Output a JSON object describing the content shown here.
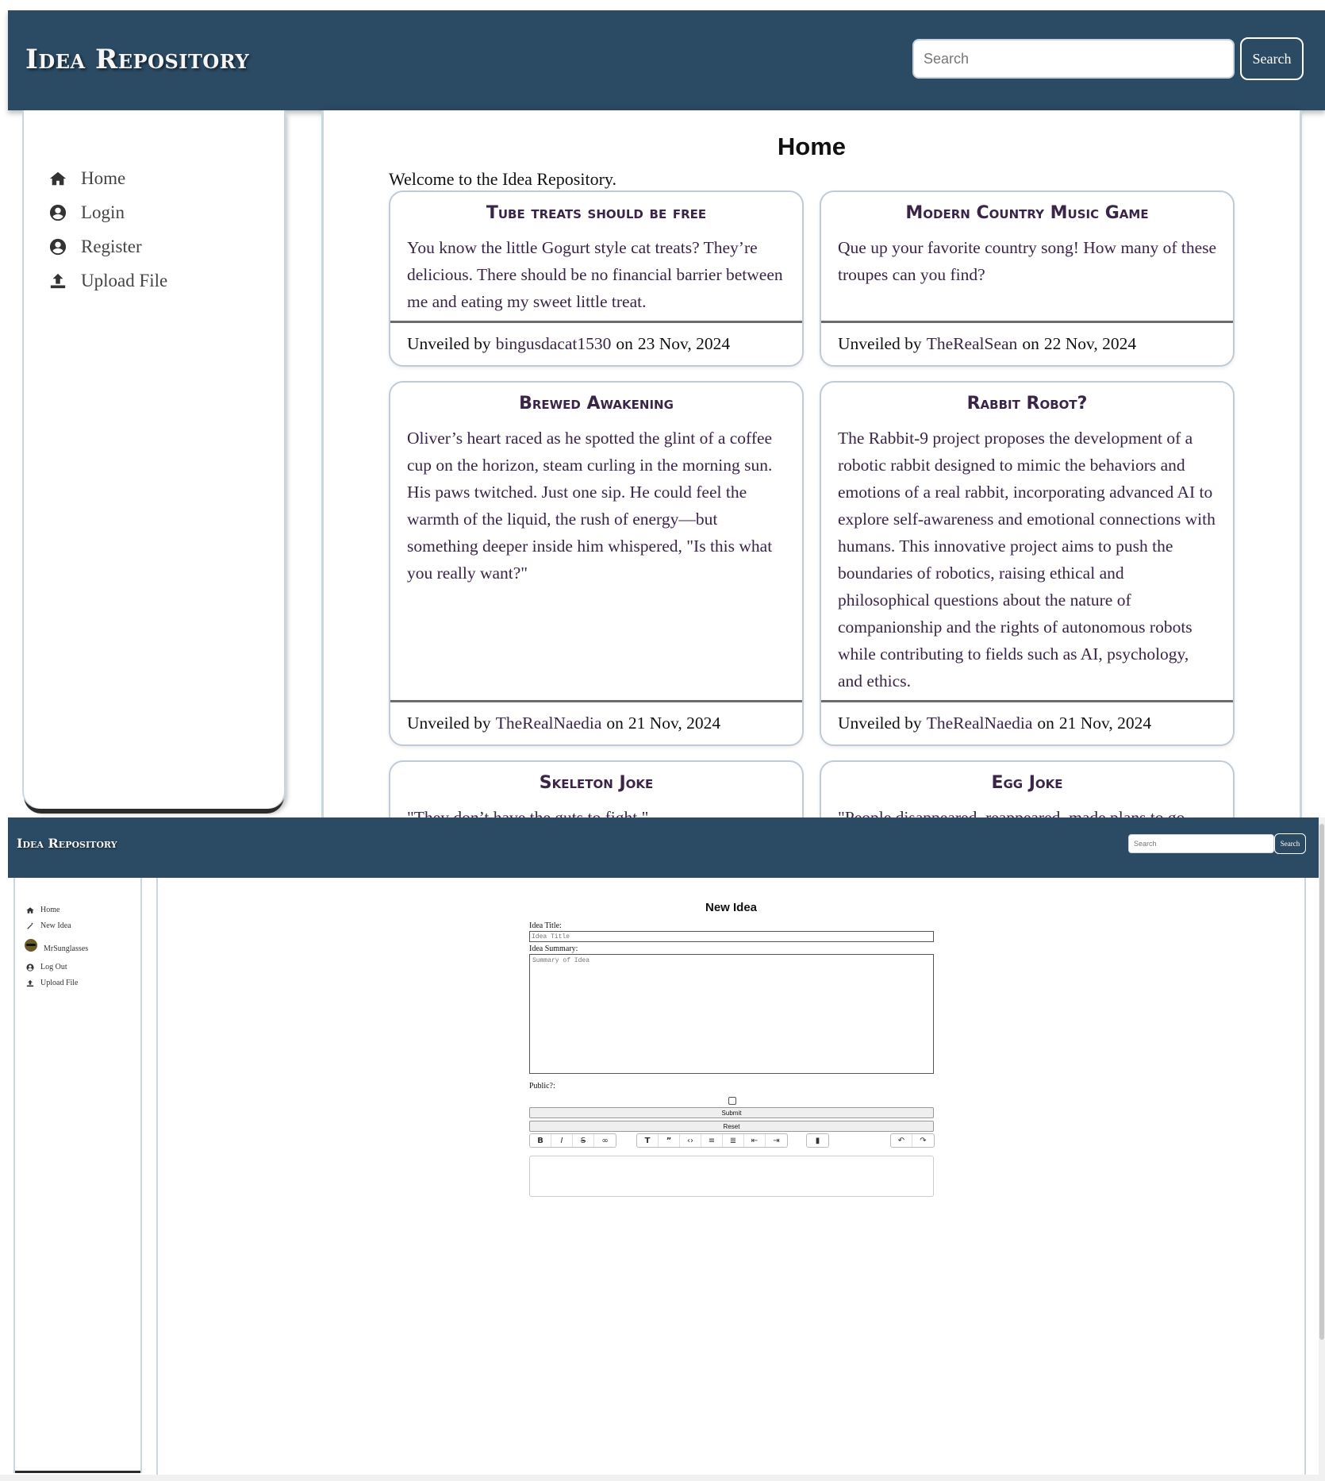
{
  "home_page": {
    "header": {
      "brand": "Idea Repository",
      "search_placeholder": "Search",
      "search_button": "Search"
    },
    "sidebar": {
      "items": [
        {
          "label": "Home",
          "icon": "home-icon"
        },
        {
          "label": "Login",
          "icon": "user-circle-icon"
        },
        {
          "label": "Register",
          "icon": "user-circle-icon"
        },
        {
          "label": "Upload File",
          "icon": "upload-icon"
        }
      ]
    },
    "main": {
      "title": "Home",
      "welcome": "Welcome to the Idea Repository.",
      "footer_prefix": "Unveiled by",
      "footer_on": "on",
      "cards": [
        {
          "title": "Tube treats should be free",
          "body": "You know the little Gogurt style cat treats? They’re delicious. There should be no financial barrier between me and eating my sweet little treat.",
          "author": "bingusdacat1530",
          "date": "23 Nov, 2024"
        },
        {
          "title": "Modern Country Music Game",
          "body": "Que up your favorite country song! How many of these troupes can you find?",
          "author": "TheRealSean",
          "date": "22 Nov, 2024"
        },
        {
          "title": "Brewed Awakening",
          "body": "Oliver’s heart raced as he spotted the glint of a coffee cup on the horizon, steam curling in the morning sun. His paws twitched. Just one sip. He could feel the warmth of the liquid, the rush of energy—but something deeper inside him whispered, \"Is this what you really want?\"",
          "author": "TheRealNaedia",
          "date": "21 Nov, 2024"
        },
        {
          "title": "Rabbit Robot?",
          "body": "The Rabbit-9 project proposes the development of a robotic rabbit designed to mimic the behaviors and emotions of a real rabbit, incorporating advanced AI to explore self-awareness and emotional connections with humans. This innovative project aims to push the boundaries of robotics, raising ethical and philosophical questions about the nature of companionship and the rights of autonomous robots while contributing to fields such as AI, psychology, and ethics.",
          "author": "TheRealNaedia",
          "date": "21 Nov, 2024"
        },
        {
          "title": "Skeleton Joke",
          "body": "\"They don’t have the guts to fight.\"",
          "author": "",
          "date": ""
        },
        {
          "title": "Egg Joke",
          "body": "\"People disappeared, reappeared, made plans to go",
          "author": "",
          "date": ""
        }
      ]
    }
  },
  "new_idea_page": {
    "header": {
      "brand": "Idea Repository",
      "search_placeholder": "Search",
      "search_button": "Search"
    },
    "sidebar": {
      "items": [
        {
          "label": "Home",
          "icon": "home-icon"
        },
        {
          "label": "New Idea",
          "icon": "magic-wand-icon"
        },
        {
          "label": "MrSunglasses",
          "icon": "avatar-sunglasses-icon"
        },
        {
          "label": "Log Out",
          "icon": "user-circle-icon"
        },
        {
          "label": "Upload File",
          "icon": "upload-icon"
        }
      ]
    },
    "form": {
      "title": "New Idea",
      "title_label": "Idea Title:",
      "title_placeholder": "Idea Title",
      "summary_label": "Idea Summary:",
      "summary_placeholder": "Summary of Idea",
      "public_label": "Public?:",
      "public_checked": false,
      "submit_label": "Submit",
      "reset_label": "Reset",
      "toolbar": [
        "bold-icon",
        "italic-icon",
        "strikethrough-icon",
        "link-icon",
        "heading-icon",
        "quote-icon",
        "code-icon",
        "bullet-list-icon",
        "numbered-list-icon",
        "outdent-icon",
        "indent-icon",
        "attachment-icon",
        "undo-icon",
        "redo-icon"
      ]
    }
  }
}
